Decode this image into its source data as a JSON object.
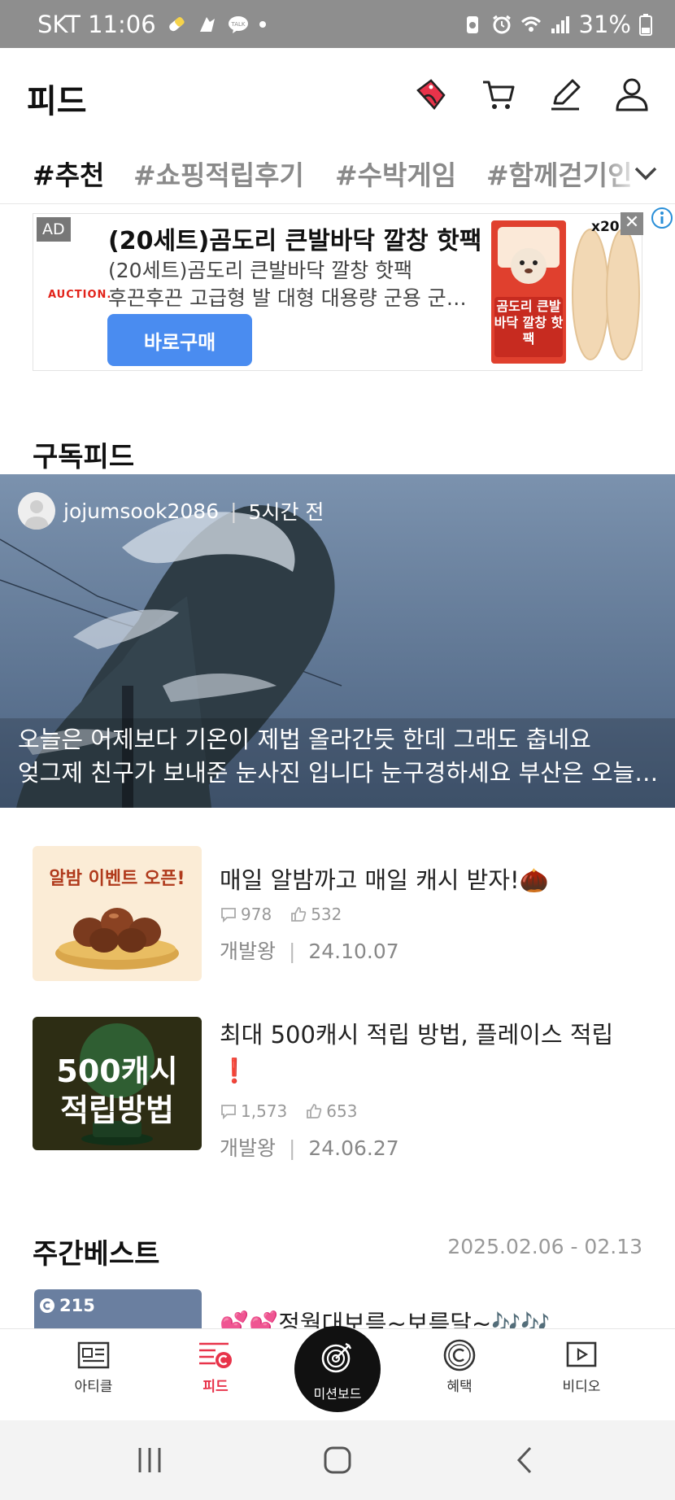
{
  "status": {
    "carrier_time": "SKT 11:06",
    "battery": "31%"
  },
  "header": {
    "title": "피드"
  },
  "tabs": [
    {
      "label": "#추천"
    },
    {
      "label": "#쇼핑적립후기"
    },
    {
      "label": "#수박게임"
    },
    {
      "label": "#함께걷기인"
    }
  ],
  "ad": {
    "badge": "AD",
    "brand": "AUCTION.",
    "title": "(20세트)곰도리 큰발바닥 깔창 핫팩",
    "subtitle": "(20세트)곰도리 큰발바닥 깔창 핫팩",
    "description": "후끈후끈 고급형 발 대형 대용량 군용 군화용",
    "button": "바로구매",
    "image_tag": "x20",
    "image_text": "곰도리 큰발바닥 깔창 핫팩"
  },
  "subscribed": {
    "title": "구독피드",
    "post": {
      "author": "jojumsook2086",
      "time": "5시간 전",
      "line1": "오늘은 어제보다 기온이 제법  올라간듯 한데 그래도 춥네요",
      "line2": "엊그제 친구가 보내준 눈사진 입니다  눈구경하세요 부산은 오늘도 맑음"
    }
  },
  "articles": [
    {
      "thumb_text": "알밤 이벤트 오픈!",
      "title": "매일 알밤까고 매일 캐시 받자!🌰",
      "comments": "978",
      "likes": "532",
      "author": "개발왕",
      "date": "24.10.07"
    },
    {
      "thumb_line1": "500캐시",
      "thumb_line2": "적립방법",
      "title_line1": "최대 500캐시 적립 방법, 플레이스 적립",
      "title_line2": "❗",
      "comments": "1,573",
      "likes": "653",
      "author": "개발왕",
      "date": "24.06.27"
    }
  ],
  "weekly": {
    "title": "주간베스트",
    "range": "2025.02.06 - 02.13",
    "badge_count": "215",
    "first_title": "💕💕정월대보름~보름달~🎶🎶"
  },
  "nav": {
    "article": "아티클",
    "feed": "피드",
    "mission": "미션보드",
    "benefit": "혜택",
    "video": "비디오"
  },
  "colors": {
    "accent": "#e8334a",
    "ad_button": "#4a8cf0"
  }
}
